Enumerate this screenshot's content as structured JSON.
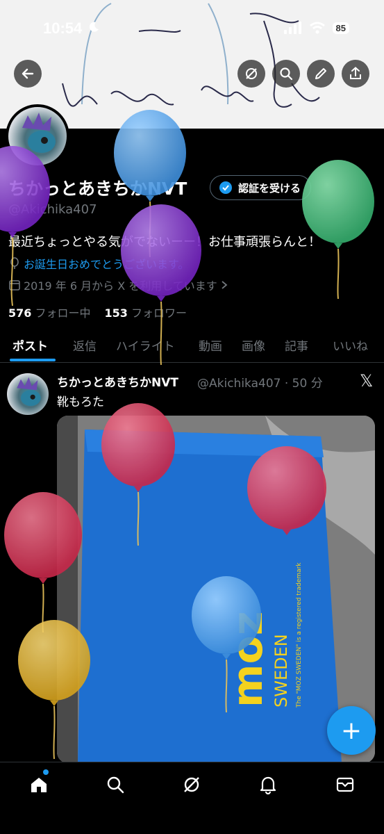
{
  "status_bar": {
    "time": "10:54",
    "battery": "85"
  },
  "header": {
    "back_icon": "arrow-left-icon",
    "actions": [
      "grok-icon",
      "search-icon",
      "pencil-icon",
      "share-icon"
    ]
  },
  "profile": {
    "name": "ちかっとあきちかNVT",
    "handle": "@Akichika407",
    "verify_label": "認証を受ける",
    "bio": "最近ちょっとやる気がでないーー！お仕事頑張らんと！",
    "birthday": "お誕生日おめでとうございます。",
    "joined": "2019 年 6 月から X を利用しています",
    "following_count": "576",
    "following_label": "フォロー中",
    "followers_count": "153",
    "followers_label": "フォロワー"
  },
  "tabs": [
    "ポスト",
    "返信",
    "ハイライト",
    "動画",
    "画像",
    "記事",
    "いいね"
  ],
  "post": {
    "name": "ちかっとあきちかNVT",
    "handle": "@Akichika407",
    "time": "50 分",
    "text": "靴もろた"
  },
  "image_text": {
    "brand": "moz",
    "subline": "SWEDEN",
    "trademark": "The \"MOZ SWEDEN\" is a registered trademark"
  },
  "fab_label": "+",
  "bottom_nav": [
    "home-icon",
    "search-icon",
    "grok-icon",
    "bell-icon",
    "mail-icon"
  ],
  "balloon_colors": [
    "#5aa9ec",
    "#8a3fd1",
    "#5cc98a",
    "#d63a5a",
    "#e8b93a"
  ]
}
